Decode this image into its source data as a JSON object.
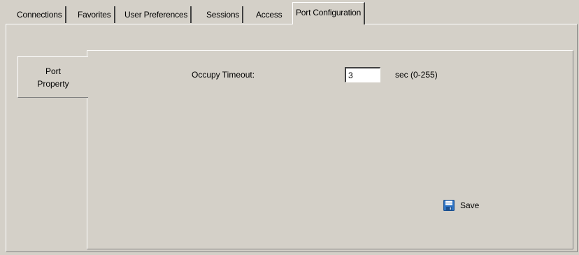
{
  "tabs": [
    {
      "label": "Connections"
    },
    {
      "label": "Favorites"
    },
    {
      "label": "User Preferences"
    },
    {
      "label": "Sessions"
    },
    {
      "label": "Access"
    },
    {
      "label": "Port Configuration"
    }
  ],
  "active_tab": "Port Configuration",
  "side_tab": {
    "line1": "Port",
    "line2": "Property"
  },
  "form": {
    "occupy_label": "Occupy Timeout:",
    "occupy_value": "3",
    "range_label": "sec (0-255)"
  },
  "save": {
    "label": "Save",
    "icon": "floppy-disk-icon"
  },
  "colors": {
    "face": "#d4d0c8",
    "save_icon": "#2d73c4"
  }
}
